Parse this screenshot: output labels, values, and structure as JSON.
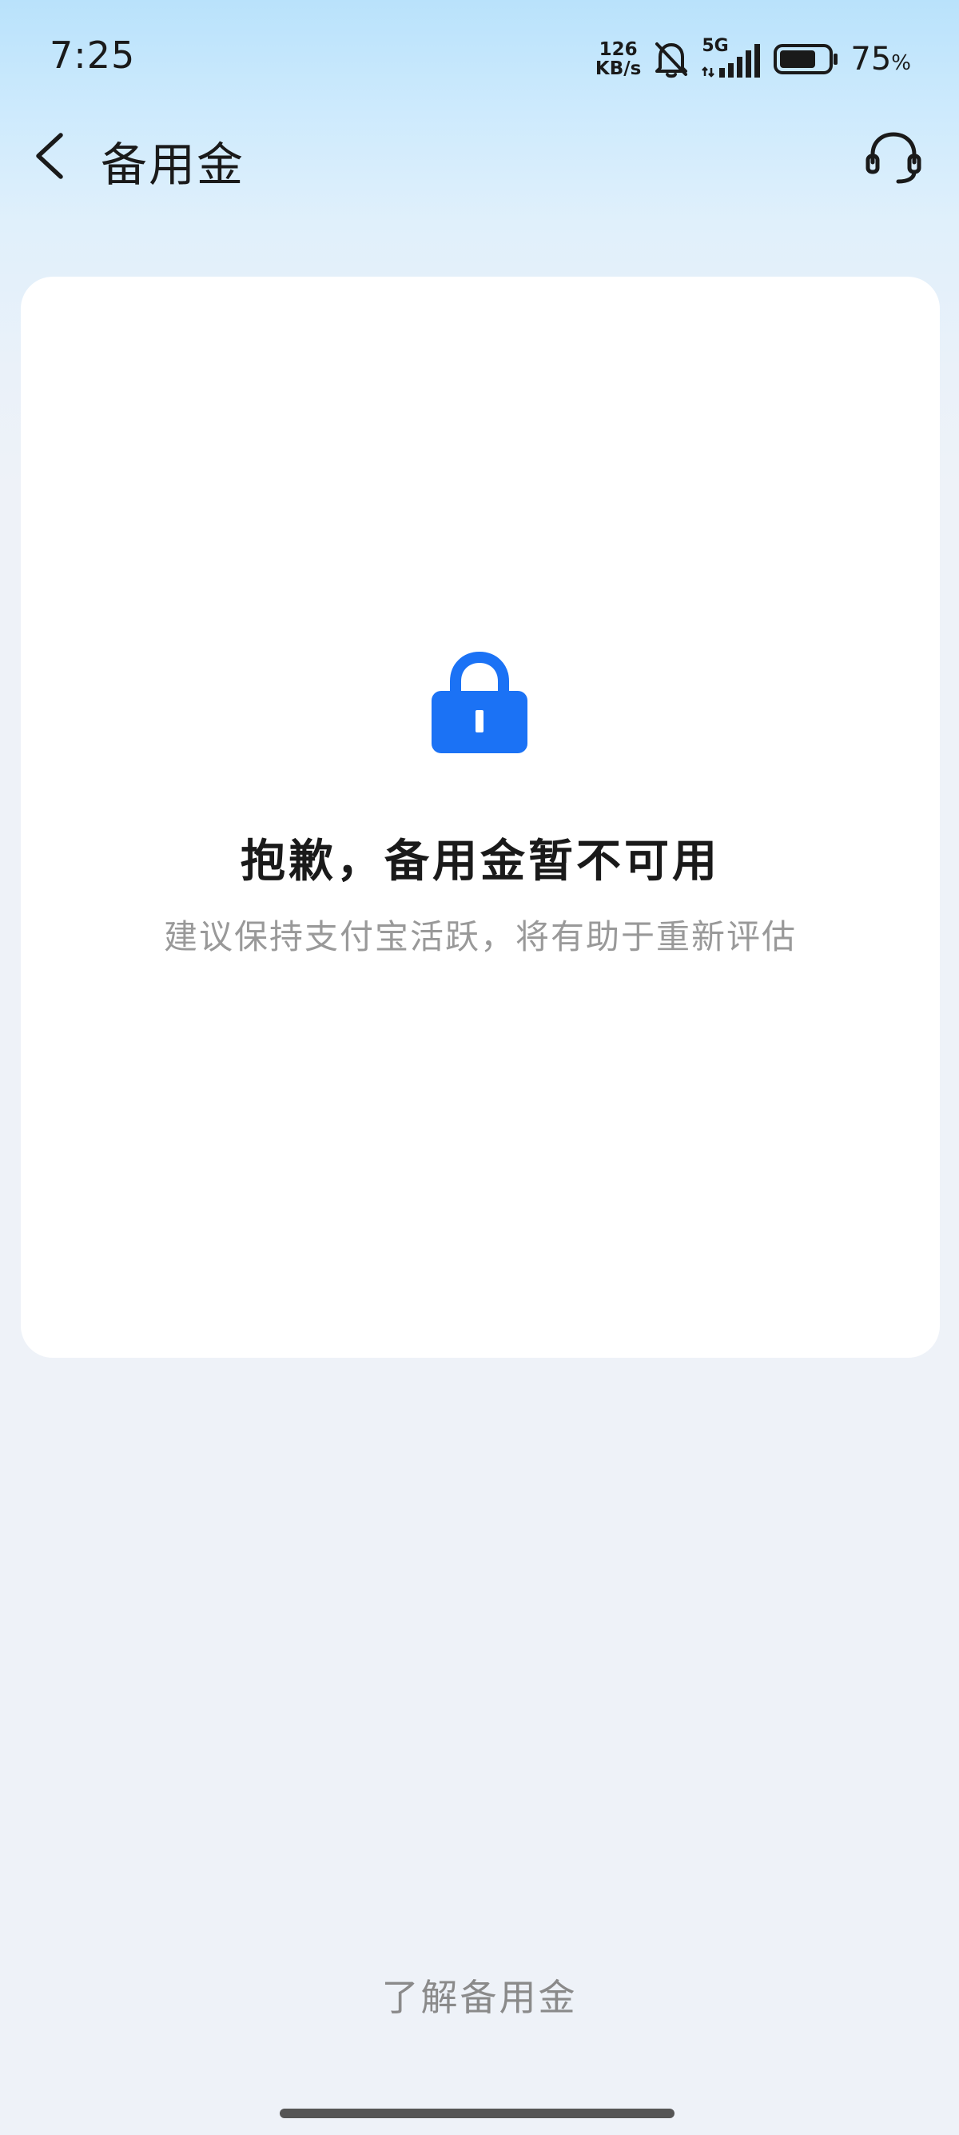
{
  "status_bar": {
    "time": "7:25",
    "net_speed_value": "126",
    "net_speed_unit": "KB/s",
    "network_type": "5G",
    "battery_percent": "75",
    "battery_unit": "%",
    "battery_level": 0.75,
    "icons": [
      "bell-muted-icon",
      "signal-icon",
      "battery-icon"
    ]
  },
  "nav": {
    "title": "备用金",
    "back_icon": "chevron-left-icon",
    "support_icon": "headset-icon"
  },
  "card": {
    "icon": "lock-icon",
    "title": "抱歉，备用金暂不可用",
    "subtitle": "建议保持支付宝活跃，将有助于重新评估"
  },
  "footer": {
    "learn_more": "了解备用金"
  },
  "colors": {
    "accent": "#1b72f5",
    "page_bg": "#eef2f8",
    "header_gradient_top": "#b9e2fb"
  }
}
